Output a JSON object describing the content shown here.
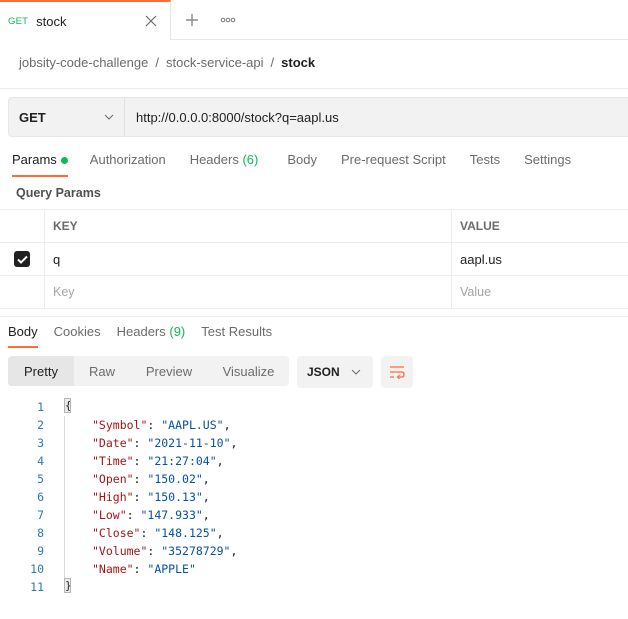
{
  "tab": {
    "method": "GET",
    "name": "stock"
  },
  "breadcrumb": {
    "items": [
      "jobsity-code-challenge",
      "stock-service-api"
    ],
    "current": "stock",
    "separator": "/"
  },
  "request": {
    "method": "GET",
    "url": "http://0.0.0.0:8000/stock?q=aapl.us"
  },
  "request_tabs": {
    "params": "Params",
    "authorization": "Authorization",
    "headers": "Headers",
    "headers_count": "(6)",
    "body": "Body",
    "pre_request": "Pre-request Script",
    "tests": "Tests",
    "settings": "Settings"
  },
  "query_params": {
    "title": "Query Params",
    "columns": {
      "key": "KEY",
      "value": "VALUE"
    },
    "rows": [
      {
        "checked": true,
        "key": "q",
        "value": "aapl.us"
      }
    ],
    "placeholders": {
      "key": "Key",
      "value": "Value"
    }
  },
  "response_tabs": {
    "body": "Body",
    "cookies": "Cookies",
    "headers": "Headers",
    "headers_count": "(9)",
    "test_results": "Test Results"
  },
  "view": {
    "modes": [
      "Pretty",
      "Raw",
      "Preview",
      "Visualize"
    ],
    "active": "Pretty",
    "format": "JSON"
  },
  "response_body": {
    "open_brace": "{",
    "close_brace": "}",
    "fields": [
      {
        "key": "\"Symbol\"",
        "value": "\"AAPL.US\"",
        "comma": ","
      },
      {
        "key": "\"Date\"",
        "value": "\"2021-11-10\"",
        "comma": ","
      },
      {
        "key": "\"Time\"",
        "value": "\"21:27:04\"",
        "comma": ","
      },
      {
        "key": "\"Open\"",
        "value": "\"150.02\"",
        "comma": ","
      },
      {
        "key": "\"High\"",
        "value": "\"150.13\"",
        "comma": ","
      },
      {
        "key": "\"Low\"",
        "value": "\"147.933\"",
        "comma": ","
      },
      {
        "key": "\"Close\"",
        "value": "\"148.125\"",
        "comma": ","
      },
      {
        "key": "\"Volume\"",
        "value": "\"35278729\"",
        "comma": ","
      },
      {
        "key": "\"Name\"",
        "value": "\"APPLE\"",
        "comma": ""
      }
    ],
    "line_numbers": [
      "1",
      "2",
      "3",
      "4",
      "5",
      "6",
      "7",
      "8",
      "9",
      "10",
      "11"
    ]
  },
  "colors": {
    "accent": "#ff6c37",
    "success": "#0cbb52",
    "json_key": "#a31515",
    "json_string": "#0451a5"
  }
}
